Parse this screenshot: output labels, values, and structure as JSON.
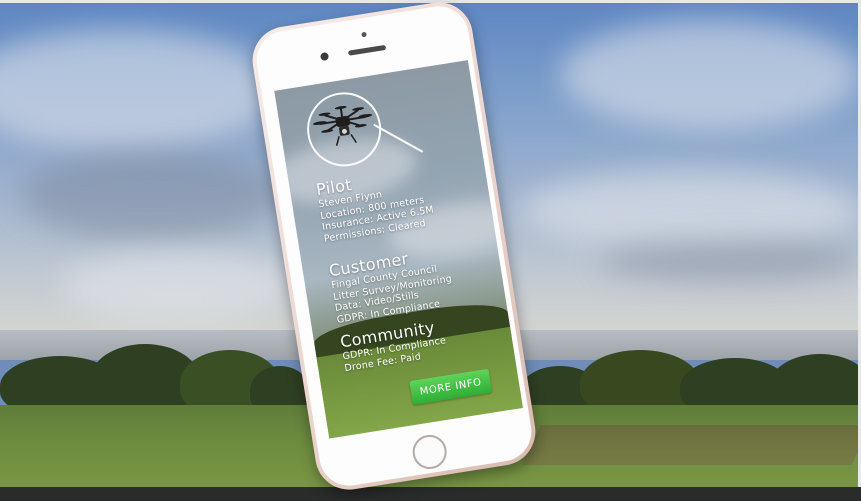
{
  "pilot": {
    "heading": "Pilot",
    "lines": [
      "Steven Flynn",
      "Location: 800 meters",
      "Insurance: Active 6.5M",
      "Permissions: Cleared"
    ]
  },
  "customer": {
    "heading": "Customer",
    "lines": [
      "Fingal County Council",
      "Litter Survey/Monitoring",
      "Data: Video/Stills",
      "GDPR: In Compliance"
    ]
  },
  "community": {
    "heading": "Community",
    "lines": [
      "GDPR: In Compliance",
      "Drone Fee: Paid"
    ]
  },
  "button": {
    "label": "MORE INFO"
  },
  "colors": {
    "button_green": "#3bbf3e",
    "text": "#ffffff"
  },
  "icons": {
    "target": "drone-target-icon",
    "drone": "drone-icon"
  }
}
